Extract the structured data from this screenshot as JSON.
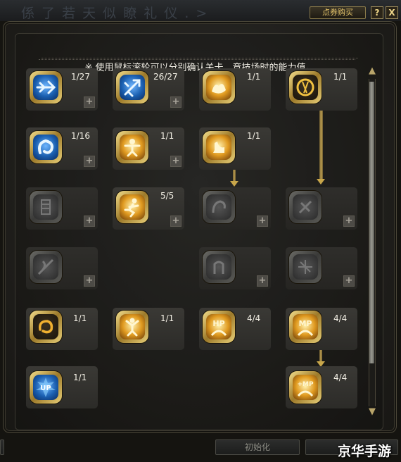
{
  "header": {
    "faded_title": "係 了 若 天 似 瞭 礼 仪 . >",
    "shop_label": "点券购买",
    "help_label": "?",
    "close_label": "X"
  },
  "notice": "※ 使用鼠标滚轮可以分别确认关卡、竞技场时的能力值。",
  "skills": [
    {
      "count": "1/27",
      "icon": "blue-arrow-icon",
      "active": true
    },
    {
      "count": "26/27",
      "icon": "blue-arrow-burst-icon",
      "active": true
    },
    {
      "count": "1/1",
      "icon": "gold-wing-icon",
      "active": true
    },
    {
      "count": "1/1",
      "icon": "gold-dash-icon",
      "active": true
    },
    {
      "count": "1/16",
      "icon": "blue-swirl-icon",
      "active": true
    },
    {
      "count": "1/1",
      "icon": "gold-figure-icon",
      "active": true
    },
    {
      "count": "1/1",
      "icon": "gold-hand-icon",
      "active": true
    },
    {
      "count": "",
      "icon": "locked-figure-icon",
      "active": false
    },
    {
      "count": "5/5",
      "icon": "gold-run-icon",
      "active": true
    },
    {
      "count": "",
      "icon": "locked-claw-icon",
      "active": false
    },
    {
      "count": "",
      "icon": "locked-burst-icon",
      "active": false
    },
    {
      "count": "",
      "icon": "locked-slash-icon",
      "active": false
    },
    {
      "count": "",
      "icon": "locked-hand-icon",
      "active": false
    },
    {
      "count": "",
      "icon": "locked-spark-icon",
      "active": false
    },
    {
      "count": "1/1",
      "icon": "gold-ring-icon",
      "active": true
    },
    {
      "count": "1/1",
      "icon": "gold-jump-icon",
      "active": true
    },
    {
      "count": "4/4",
      "icon": "hp-icon",
      "active": true
    },
    {
      "count": "4/4",
      "icon": "mp-icon",
      "active": true
    },
    {
      "count": "1/1",
      "icon": "up-icon",
      "active": true
    },
    {
      "count": "4/4",
      "icon": "mp-plus-icon",
      "active": true
    }
  ],
  "icon_text": {
    "hp": "HP",
    "mp": "MP",
    "up": "UP",
    "mp_plus": "+MP"
  },
  "buttons": {
    "reset_label": "初始化"
  },
  "watermark": "京华手游"
}
